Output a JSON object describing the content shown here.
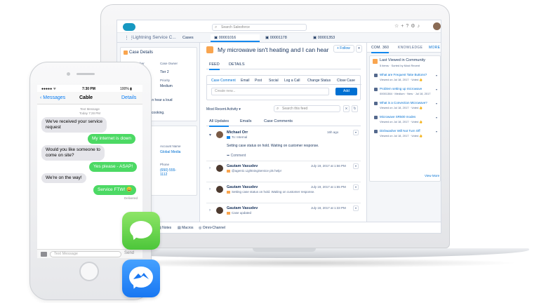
{
  "sf": {
    "search_placeholder": "Search Salesforce",
    "app_name": "Lightning Service C...",
    "tabs": [
      "Cases",
      "00001016",
      "00001178",
      "00001353"
    ],
    "case_title": "My microwave isn't heating and I can hear a loud ...",
    "follow": "+ Follow",
    "feed_tabs": [
      "FEED",
      "DETAILS"
    ],
    "publisher_tabs": [
      "Case Comment",
      "Email",
      "Post",
      "Social",
      "Log a Call",
      "Change Status",
      "Close Case"
    ],
    "new_note_placeholder": "Create new...",
    "add_label": "Add",
    "most_recent": "Most Recent Activity",
    "search_feed": "Search this feed",
    "filter_tabs": [
      "All Updates",
      "Emails",
      "Case Comments"
    ],
    "feed": [
      {
        "name": "Michael Orr",
        "sub": "To: Internal",
        "time": "16h ago",
        "body": "Setting case status on hold. Waiting on customer response.",
        "comment": "Comment"
      },
      {
        "name": "Gautam Vasudev",
        "sub": "@agent1 LightningService pls help!",
        "time": "July 19, 2017 at 1:56 PM"
      },
      {
        "name": "Gautam Vasudev",
        "sub": "Setting case status on hold. Waiting on customer response.",
        "time": "July 19, 2017 at 1:55 PM"
      },
      {
        "name": "Gautam Vasudev",
        "sub": "Case updated",
        "time": "July 18, 2017 at 1:33 PM"
      }
    ],
    "left": {
      "case_details": "Case Details",
      "fields": [
        {
          "label": "Case Number",
          "value": ""
        },
        {
          "label": "Case Owner",
          "value": ""
        },
        {
          "label": "",
          "value": "Tier 2"
        },
        {
          "label": "Priority",
          "value": "Medium"
        }
      ],
      "desc1": "t heating and I can hear a loud",
      "desc2": "but the food isn't cooking.",
      "contact_details": "act Details",
      "cfields": [
        {
          "label": "Account Name",
          "value": "Global Media"
        },
        {
          "label": "Phone",
          "value": "(650) 555-1112"
        }
      ],
      "left_val1": "mia",
      "left_val2": "om"
    },
    "right": {
      "tabs": [
        "COM. 360",
        "KNOWLEDGE",
        "MORE"
      ],
      "card_title": "Last Viewed in Community",
      "card_sub": "5 items · Sorted by Most Recent",
      "articles": [
        {
          "title": "What are Frequent Take Buttons?",
          "date": "Viewed on Jul 18, 2017 · Voted 👍"
        },
        {
          "title": "Problem setting up microwave",
          "date": "00001384 · Medium · New · Jul 18, 2017"
        },
        {
          "title": "What is a Convection Microwave?",
          "date": "Viewed on Jul 18, 2017 · Voted 👍"
        },
        {
          "title": "Microwave SR500 modes",
          "date": "Viewed on Jul 18, 2017 · Voted 👍"
        },
        {
          "title": "Dishwasher Will Not Turn Off",
          "date": "Viewed on Jul 18, 2017 · Voted 👍"
        }
      ],
      "view_more": "View More"
    },
    "utility": [
      "Notes",
      "Macros",
      "Omni-Channel"
    ]
  },
  "phone": {
    "time": "7:30 PM",
    "battery": "100%",
    "back": "Messages",
    "contact": "Cable",
    "details": "Details",
    "timestamp1": "Text Message",
    "timestamp2": "Today 7:28 PM",
    "messages": [
      {
        "dir": "in",
        "text": "We've received your service\nrequest"
      },
      {
        "dir": "out",
        "text": "My internet is down"
      },
      {
        "dir": "in",
        "text": "Would you like someone to\ncome on site?"
      },
      {
        "dir": "out",
        "text": "Yes please - ASAP!"
      },
      {
        "dir": "in",
        "text": "We're on the way!"
      },
      {
        "dir": "out",
        "text": "Service FTW! 😀"
      }
    ],
    "delivered": "Delivered",
    "input_placeholder": "Text Message",
    "send": "Send"
  }
}
